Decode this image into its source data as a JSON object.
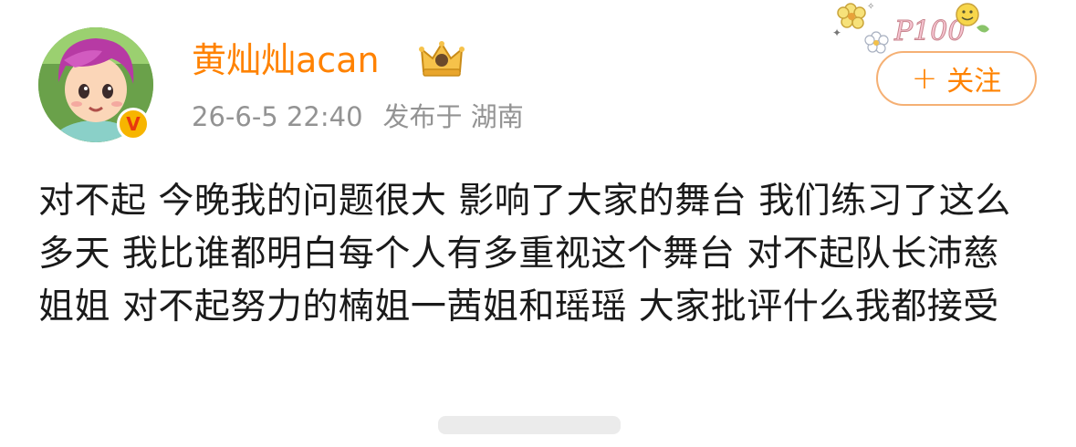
{
  "post": {
    "author": "黄灿灿acan",
    "timestamp": "26-6-5 22:40",
    "published_at": "发布于 湖南",
    "follow_label": "关注",
    "follow_prefix": "+",
    "content": "对不起 今晚我的问题很大 影响了大家的舞台 我们练习了这么多天 我比谁都明白每个人有多重视这个舞台 对不起队长沛慈姐姐 对不起努力的楠姐一茜姐和瑶瑶 大家批评什么我都接受"
  },
  "icons": {
    "avatar": "cartoon-avatar",
    "verified": "verified-v-badge",
    "crown": "vip-crown-icon",
    "follow": "plus-icon",
    "decoration": "flower-sticker-icon"
  },
  "colors": {
    "accent": "#ff8200",
    "meta_text": "#939393",
    "body_text": "#1a1a1a",
    "badge": "#f7b500"
  }
}
